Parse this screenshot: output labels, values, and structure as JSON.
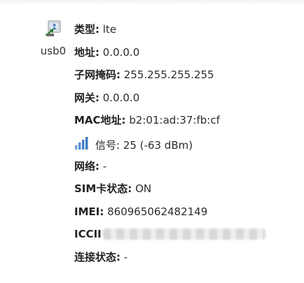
{
  "interface": {
    "label": "usb0",
    "icon": "network-interface-icon"
  },
  "details": [
    {
      "key": "类型:",
      "value": " lte"
    },
    {
      "key": "地址:",
      "value": " 0.0.0.0"
    },
    {
      "key": "子网掩码:",
      "value": " 255.255.255.255"
    },
    {
      "key": "网关:",
      "value": " 0.0.0.0"
    },
    {
      "key": "MAC地址:",
      "value": " b2:01:ad:37:fb:cf"
    },
    {
      "key": "信号:",
      "value": " 25 (-63 dBm)"
    },
    {
      "key": "网络:",
      "value": " -"
    },
    {
      "key": "SIM卡状态:",
      "value": " ON"
    },
    {
      "key": "IMEI:",
      "value": " 860965062482149"
    },
    {
      "key": "ICCII",
      "value": ""
    },
    {
      "key": "连接状态:",
      "value": " -"
    }
  ],
  "signal": {
    "icon": "signal-strength-icon",
    "color": "#3a78c2"
  }
}
